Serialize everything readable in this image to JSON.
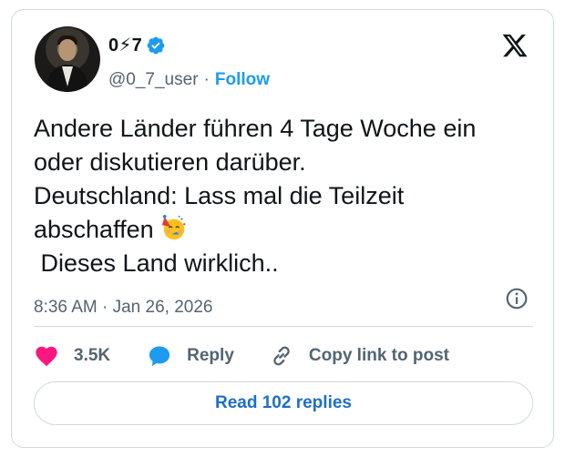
{
  "author": {
    "display_name": "0⚡7",
    "handle": "@0_7_user",
    "separator": "·",
    "follow_label": "Follow"
  },
  "tweet": {
    "line1": "Andere Länder führen 4 Tage Woche ein",
    "line2": "oder diskutieren darüber.",
    "line3": "Deutschland: Lass mal die Teilzeit",
    "line4": "abschaffen ",
    "line5": " Dieses Land wirklich.."
  },
  "meta": {
    "timestamp": "8:36 AM · Jan 26, 2026"
  },
  "actions": {
    "likes_count": "3.5K",
    "reply_label": "Reply",
    "copy_link_label": "Copy link to post"
  },
  "read_replies_label": "Read 102 replies",
  "colors": {
    "accent": "#1d9bf0",
    "like_heart": "#f91880",
    "text_secondary": "#536471",
    "border": "#cfd9de"
  },
  "icons": {
    "logo": "x-logo-icon",
    "verified": "verified-badge-icon",
    "info": "info-icon",
    "like": "heart-icon",
    "reply": "speech-bubble-icon",
    "copy": "link-icon",
    "emoji": "partying-face-emoji"
  }
}
